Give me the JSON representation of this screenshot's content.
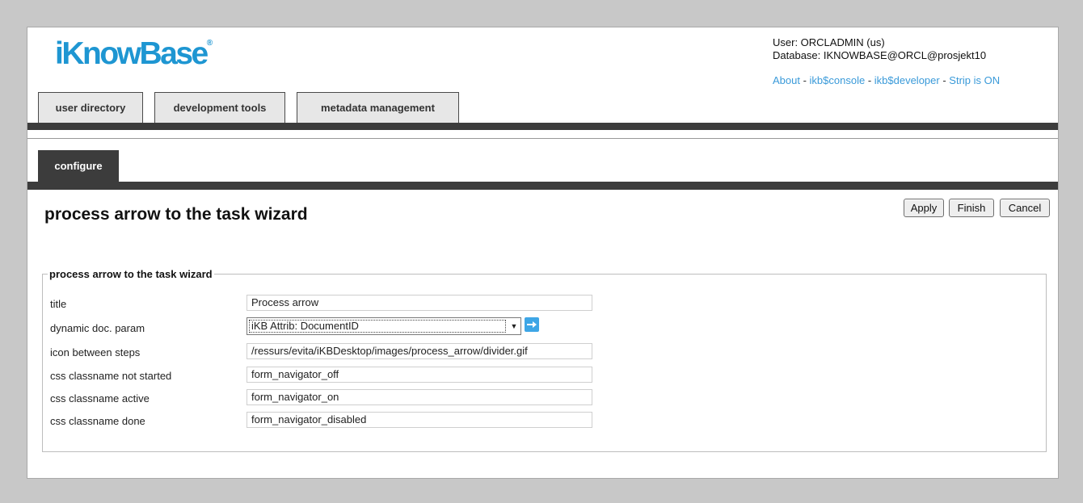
{
  "header": {
    "logo_text": "iKnowBase",
    "logo_mark": "®",
    "user_line": "User: ORCLADMIN (us)",
    "database_line": "Database: IKNOWBASE@ORCL@prosjekt10",
    "links": {
      "about": "About",
      "console": "ikb$console",
      "developer": "ikb$developer",
      "strip": "Strip is ON",
      "separator": " - "
    },
    "brand_color": "#1e96d2"
  },
  "nav": {
    "tabs": [
      {
        "label": "user directory"
      },
      {
        "label": "development tools"
      },
      {
        "label": "metadata management"
      }
    ],
    "subtab": "configure"
  },
  "page": {
    "title": "process arrow to the task wizard",
    "buttons": {
      "apply": "Apply",
      "finish": "Finish",
      "cancel": "Cancel"
    }
  },
  "form": {
    "legend": "process arrow to the task wizard",
    "fields": [
      {
        "label": "title",
        "value": "Process arrow"
      },
      {
        "label": "dynamic doc. param",
        "value": "iKB Attrib: DocumentID"
      },
      {
        "label": "icon between steps",
        "value": "/ressurs/evita/iKBDesktop/images/process_arrow/divider.gif"
      },
      {
        "label": "css classname not started",
        "value": "form_navigator_off"
      },
      {
        "label": "css classname active",
        "value": "form_navigator_on"
      },
      {
        "label": "css classname done",
        "value": "form_navigator_disabled"
      }
    ]
  }
}
